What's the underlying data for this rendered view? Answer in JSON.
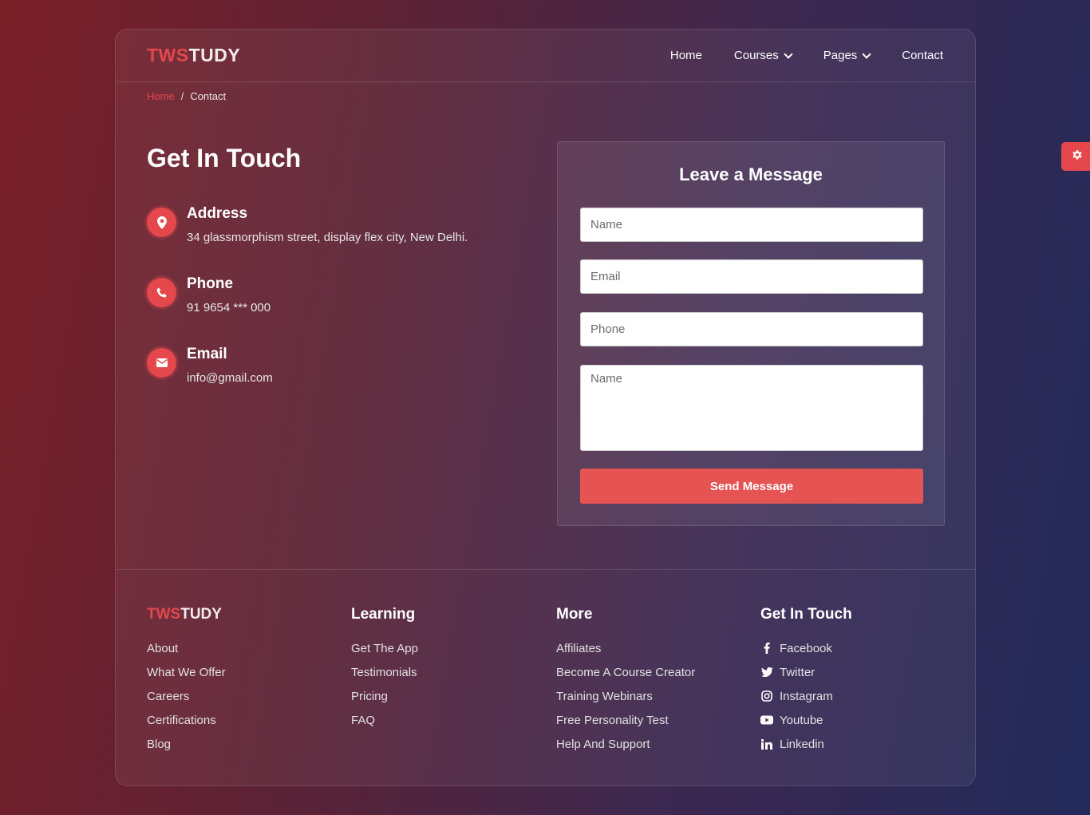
{
  "brand": {
    "part1": "TWS",
    "part2": "TUDY"
  },
  "nav": {
    "home": "Home",
    "courses": "Courses",
    "pages": "Pages",
    "contact": "Contact"
  },
  "breadcrumb": {
    "home": "Home",
    "separator": "/",
    "current": "Contact"
  },
  "contact": {
    "title": "Get In Touch",
    "address": {
      "label": "Address",
      "value": "34 glassmorphism street, display flex city, New Delhi."
    },
    "phone": {
      "label": "Phone",
      "value": "91 9654 *** 000"
    },
    "email": {
      "label": "Email",
      "value": "info@gmail.com"
    }
  },
  "form": {
    "title": "Leave a Message",
    "name_placeholder": "Name",
    "email_placeholder": "Email",
    "phone_placeholder": "Phone",
    "message_placeholder": "Name",
    "submit": "Send Message"
  },
  "footer": {
    "brand": {
      "part1": "TWS",
      "part2": "TUDY"
    },
    "about_links": [
      "About",
      "What We Offer",
      "Careers",
      "Certifications",
      "Blog"
    ],
    "learning": {
      "title": "Learning",
      "links": [
        "Get The App",
        "Testimonials",
        "Pricing",
        "FAQ"
      ]
    },
    "more": {
      "title": "More",
      "links": [
        "Affiliates",
        "Become A Course Creator",
        "Training Webinars",
        "Free Personality Test",
        "Help And Support"
      ]
    },
    "social": {
      "title": "Get In Touch",
      "links": [
        {
          "label": "Facebook",
          "icon": "facebook-icon"
        },
        {
          "label": "Twitter",
          "icon": "twitter-icon"
        },
        {
          "label": "Instagram",
          "icon": "instagram-icon"
        },
        {
          "label": "Youtube",
          "icon": "youtube-icon"
        },
        {
          "label": "Linkedin",
          "icon": "linkedin-icon"
        }
      ]
    }
  },
  "colors": {
    "accent": "#e4474c",
    "button": "#e55353"
  }
}
